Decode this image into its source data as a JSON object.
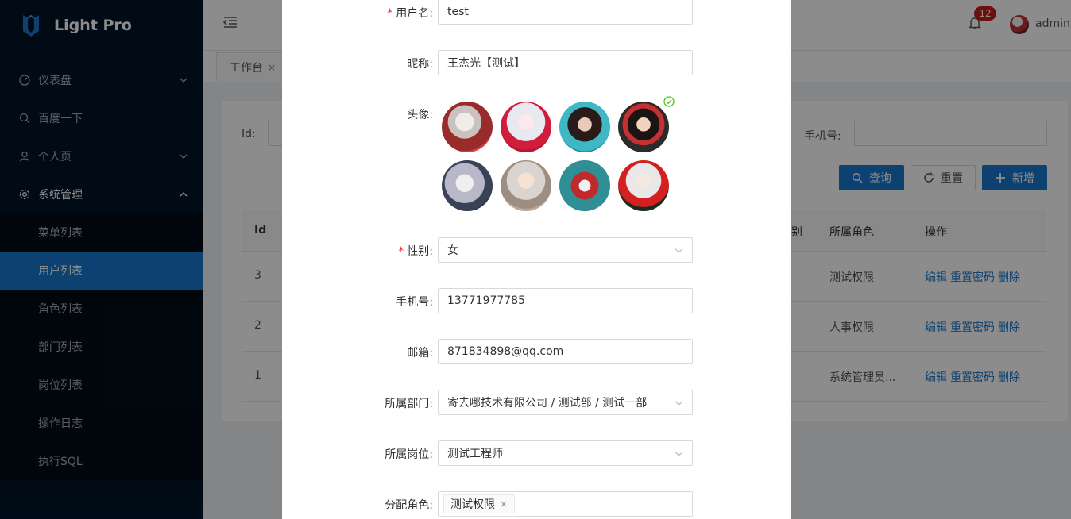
{
  "app": {
    "title": "Light Pro"
  },
  "sidebar": {
    "items": [
      {
        "label": "仪表盘",
        "icon": "dashboard-icon"
      },
      {
        "label": "百度一下",
        "icon": "search-icon"
      },
      {
        "label": "个人页",
        "icon": "user-icon"
      },
      {
        "label": "系统管理",
        "icon": "gear-icon"
      }
    ],
    "submenu": [
      {
        "label": "菜单列表"
      },
      {
        "label": "用户列表"
      },
      {
        "label": "角色列表"
      },
      {
        "label": "部门列表"
      },
      {
        "label": "岗位列表"
      },
      {
        "label": "操作日志"
      },
      {
        "label": "执行SQL"
      }
    ],
    "active_item": "用户列表"
  },
  "header": {
    "notification_count": "12",
    "username": "admin"
  },
  "tabs": [
    {
      "label": "工作台",
      "close": "×"
    }
  ],
  "filter": {
    "id_label": "Id:",
    "phone_label": "手机号:",
    "search_button": "查询",
    "reset_button": "重置",
    "add_button": "新增"
  },
  "table": {
    "headers": {
      "id": "Id",
      "gender_partial": "别",
      "role": "所属角色",
      "actions": "操作"
    },
    "rows": [
      {
        "id": "3",
        "role": "测试权限",
        "edit": "编辑",
        "reset_pwd": "重置密码",
        "delete": "删除"
      },
      {
        "id": "2",
        "role": "人事权限",
        "edit": "编辑",
        "reset_pwd": "重置密码",
        "delete": "删除"
      },
      {
        "id": "1",
        "role": "系统管理员...",
        "edit": "编辑",
        "reset_pwd": "重置密码",
        "delete": "删除"
      }
    ]
  },
  "modal": {
    "username": {
      "label": "用户名:",
      "value": "test",
      "required": "*"
    },
    "nickname": {
      "label": "昵称:",
      "value": "王杰光【测试】"
    },
    "avatar": {
      "label": "头像:",
      "selected_index": 3
    },
    "gender": {
      "label": "性别:",
      "value": "女",
      "required": "*"
    },
    "phone": {
      "label": "手机号:",
      "value": "13771977785"
    },
    "email": {
      "label": "邮箱:",
      "value": "871834898@qq.com"
    },
    "department": {
      "label": "所属部门:",
      "value": "寄去哪技术有限公司 / 测试部 / 测试一部"
    },
    "position": {
      "label": "所属岗位:",
      "value": "测试工程师"
    },
    "roles": {
      "label": "分配角色:",
      "tags": [
        "测试权限"
      ],
      "tag_close": "×"
    }
  },
  "colors": {
    "primary": "#1677ce",
    "sidebar_bg": "#001529",
    "submenu_bg": "#000c17",
    "required": "#f5222d",
    "badge": "#c51c1c",
    "success": "#52c41a"
  }
}
